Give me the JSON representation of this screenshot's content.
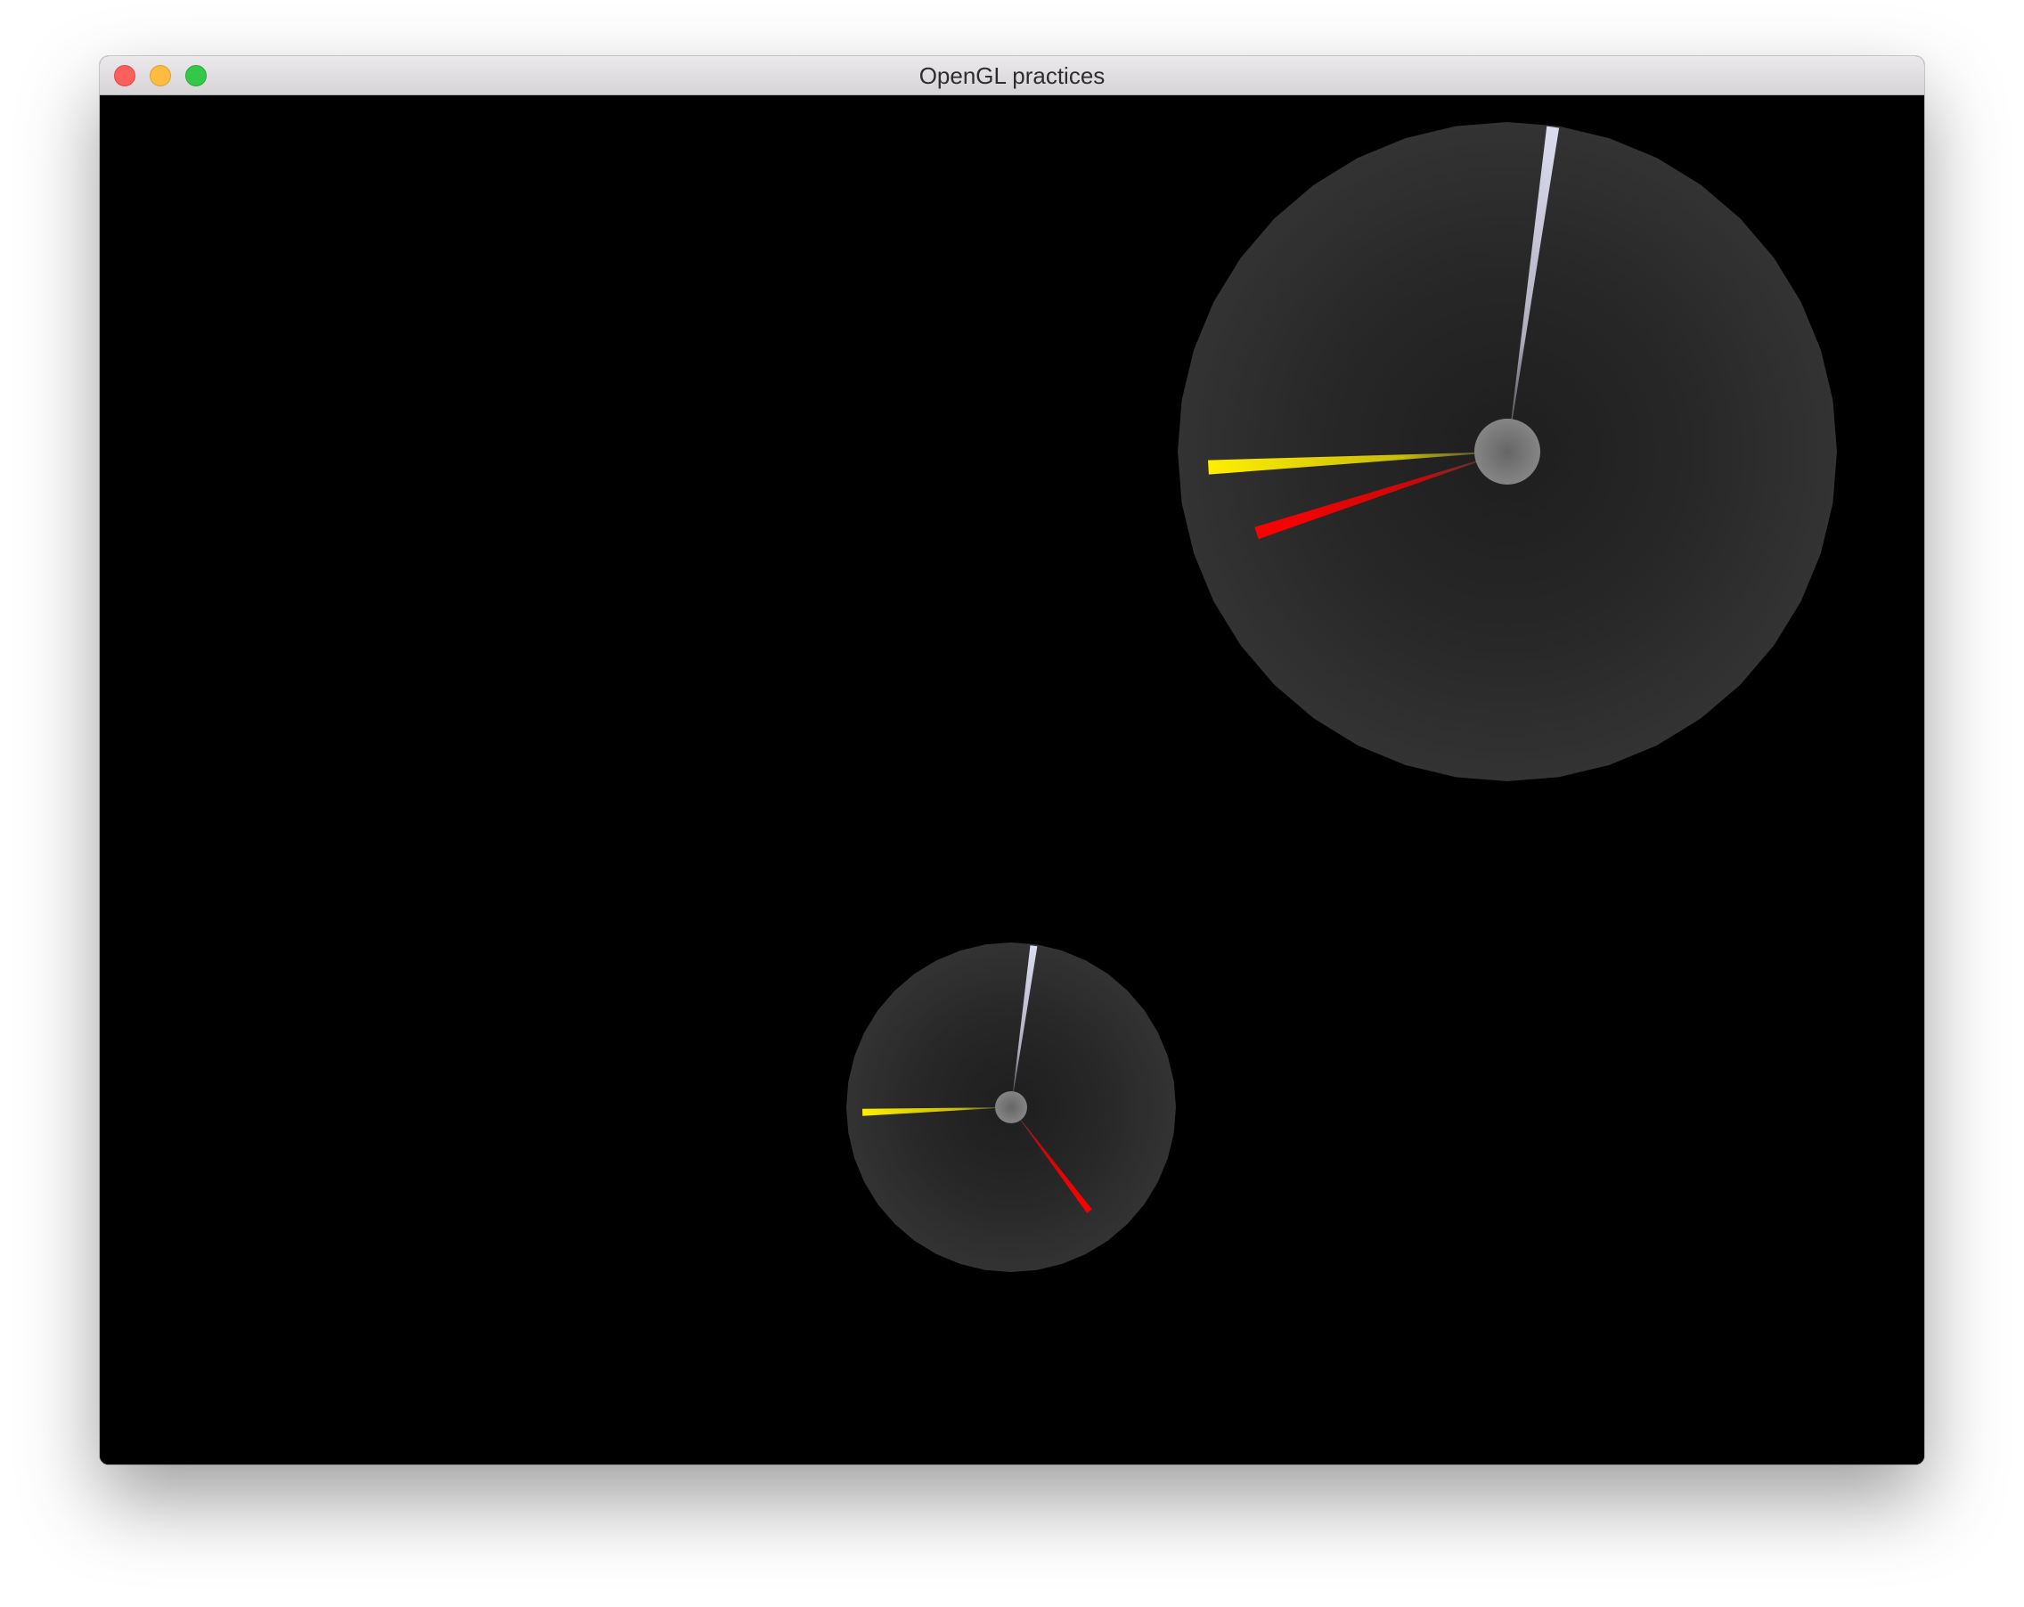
{
  "window": {
    "title": "OpenGL practices",
    "buttons": [
      "close",
      "minimize",
      "zoom"
    ]
  },
  "scene": {
    "background_color": "#000000",
    "clocks": [
      {
        "name": "large-clock",
        "face_color_edge": "#333333",
        "face_color_center": "#1e1e1e",
        "hub_color": "#7a7a7a",
        "hands": [
          {
            "name": "hour-hand",
            "color": "#ffee00",
            "angle_deg": 267
          },
          {
            "name": "minute-hand",
            "color": "#dcdcf0",
            "angle_deg": 8
          },
          {
            "name": "second-hand",
            "color": "#ff0000",
            "angle_deg": 252
          }
        ]
      },
      {
        "name": "small-clock",
        "face_color_edge": "#333333",
        "face_color_center": "#1e1e1e",
        "hub_color": "#7a7a7a",
        "hands": [
          {
            "name": "hour-hand",
            "color": "#ffee00",
            "angle_deg": 268
          },
          {
            "name": "minute-hand",
            "color": "#dcdcf0",
            "angle_deg": 8
          },
          {
            "name": "second-hand",
            "color": "#ff0000",
            "angle_deg": 143
          }
        ]
      }
    ]
  }
}
